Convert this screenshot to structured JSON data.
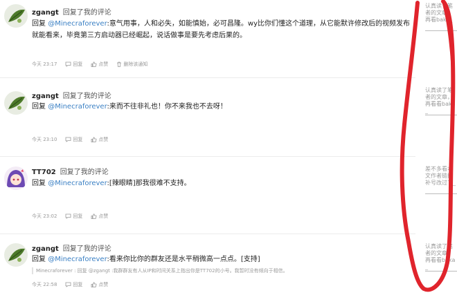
{
  "notifications": [
    {
      "user": "zgangt",
      "action": "回复了我的评论",
      "reply_prefix": "回复",
      "mention": "@Minecraforever",
      "text": ":意气用事，人和必失，如能慎始，必可昌隆。wy比你们懂这个道理，从它能默许修改后的视频发布就能看来，毕竟第三方启动器已经崛起，说话做事是要先考虑后果的。",
      "quote": "",
      "time": "今天 23:17",
      "reply_label": "回复",
      "like_label": "点赞",
      "delete_label": "删除该通知",
      "avatar": "leaf-avatar"
    },
    {
      "user": "zgangt",
      "action": "回复了我的评论",
      "reply_prefix": "回复",
      "mention": "@Minecraforever",
      "text": ":来而不往非礼也！你不来我也不去呀！",
      "quote": "",
      "time": "今天 23:10",
      "reply_label": "回复",
      "like_label": "点赞",
      "delete_label": "",
      "avatar": "leaf-avatar"
    },
    {
      "user": "TT702",
      "action": "回复了我的评论",
      "reply_prefix": "回复",
      "mention": "@Minecraforever",
      "text": ":[辣眼睛]那我很难不支持。",
      "quote": "",
      "time": "今天 23:02",
      "reply_label": "回复",
      "like_label": "点赞",
      "delete_label": "",
      "avatar": "anime-avatar"
    },
    {
      "user": "zgangt",
      "action": "回复了我的评论",
      "reply_prefix": "回复",
      "mention": "@Minecraforever",
      "text": ":看来你比你的群友还是水平稍微高一点点。[支持]",
      "quote": "Minecraforever : 回复 @zgangt :我群群友有人从IP和时间关系上指出你是TT702的小号。我暂时没有倾向于相信。",
      "time": "今天 22:58",
      "reply_label": "回复",
      "like_label": "点赞",
      "delete_label": "",
      "avatar": "leaf-avatar"
    }
  ],
  "side_snippets": [
    "认真读了笔者的文章，再看baka_",
    "认真读了笔者的文章，再看看baka_",
    "差不多看本文作者链接补号改过了_",
    "认真读了笔者的文章，再看看baka_"
  ],
  "colors": {
    "mention": "#3b80c4",
    "scribble": "#e0242c",
    "meta": "#999999"
  }
}
